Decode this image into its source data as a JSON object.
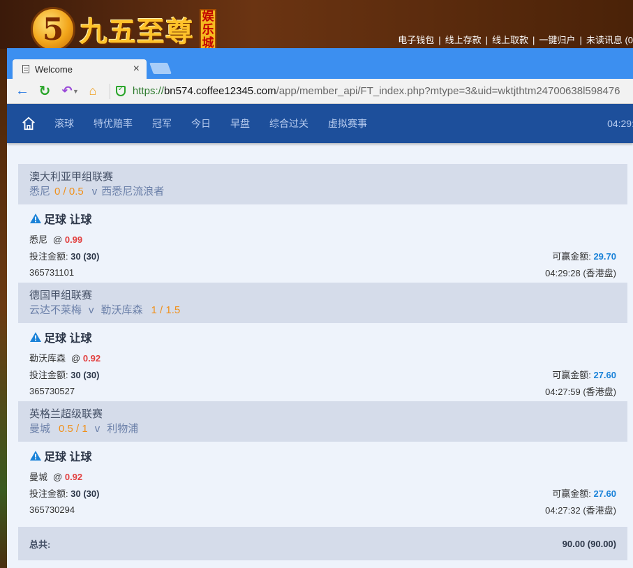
{
  "site": {
    "logo_digit": "5",
    "logo_text": "九五至尊",
    "logo_tag": [
      "娱",
      "乐",
      "城"
    ],
    "top_links": [
      "电子钱包",
      "线上存款",
      "线上取款",
      "一键归户",
      "未读讯息 (0"
    ]
  },
  "browser": {
    "tab_title": "Welcome",
    "tab_close": "×",
    "url_scheme": "https://",
    "url_host": "bn574.coffee12345.com",
    "url_path": "/app/member_api/FT_index.php?mtype=3&uid=wktjthtm24700638l598476"
  },
  "nav": {
    "items": [
      "滚球",
      "特优赔率",
      "冠军",
      "今日",
      "早盘",
      "综合过关",
      "虚拟赛事"
    ],
    "time": "04:29:"
  },
  "labels": {
    "stake": "投注金额:",
    "win": "可赢金额:",
    "at": "@",
    "vs": "v",
    "total": "总共:"
  },
  "bets": [
    {
      "league": "澳大利亚甲组联赛",
      "home": "悉尼",
      "handicap_after_home": "0 / 0.5",
      "away": "西悉尼流浪者",
      "handicap_after_away": "",
      "bet_type": "足球 让球",
      "selection": "悉尼",
      "odds": "0.99",
      "stake": "30 (30)",
      "win": "29.70",
      "ticket": "365731101",
      "time": "04:29:28 (香港盘)"
    },
    {
      "league": "德国甲组联赛",
      "home": "云达不莱梅",
      "handicap_after_home": "",
      "away": "勒沃库森",
      "handicap_after_away": "1 / 1.5",
      "bet_type": "足球 让球",
      "selection": "勒沃库森",
      "odds": "0.92",
      "stake": "30 (30)",
      "win": "27.60",
      "ticket": "365730527",
      "time": "04:27:59 (香港盘)"
    },
    {
      "league": "英格兰超级联赛",
      "home": "曼城",
      "handicap_after_home": "0.5 / 1",
      "away": "利物浦",
      "handicap_after_away": "",
      "bet_type": "足球 让球",
      "selection": "曼城",
      "odds": "0.92",
      "stake": "30 (30)",
      "win": "27.60",
      "ticket": "365730294",
      "time": "04:27:32 (香港盘)"
    }
  ],
  "total": {
    "value": "90.00 (90.00)"
  },
  "colors": {
    "nav_bg": "#1d4f9b",
    "league_bg": "#d5dcea",
    "handicap": "#f0901a",
    "odds": "#e24040",
    "win": "#1a82d8"
  }
}
